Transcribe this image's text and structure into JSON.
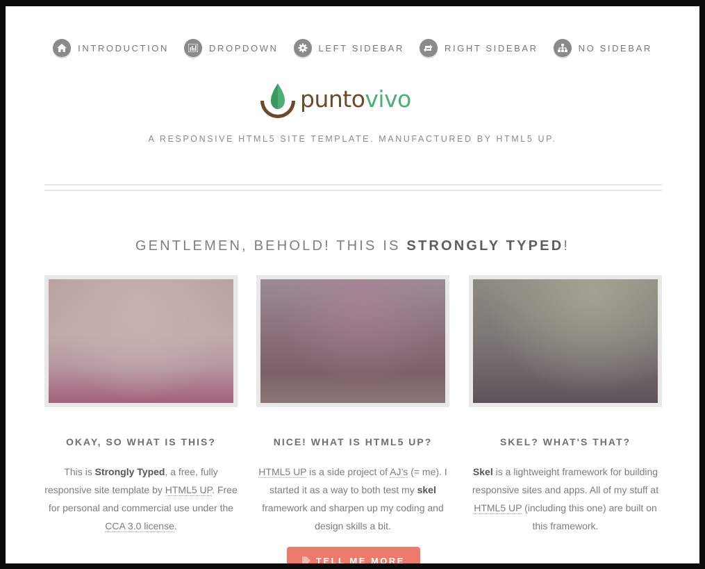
{
  "nav": {
    "items": [
      {
        "label": "INTRODUCTION",
        "icon": "home-icon"
      },
      {
        "label": "DROPDOWN",
        "icon": "bar-chart-icon"
      },
      {
        "label": "LEFT SIDEBAR",
        "icon": "gear-icon"
      },
      {
        "label": "RIGHT SIDEBAR",
        "icon": "retweet-icon"
      },
      {
        "label": "NO SIDEBAR",
        "icon": "sitemap-icon"
      }
    ]
  },
  "logo": {
    "part1": "punto",
    "part2": "vivo",
    "color1": "#6b4c2a",
    "color2": "#4caf74"
  },
  "tagline": "A RESPONSIVE HTML5 SITE TEMPLATE. MANUFACTURED BY HTML5 UP.",
  "heading": {
    "prefix": "GENTLEMEN, BEHOLD! THIS IS ",
    "strong": "STRONGLY TYPED",
    "suffix": "!"
  },
  "features": [
    {
      "title": "OKAY, SO WHAT IS THIS?",
      "t1": "This is ",
      "s1": "Strongly Typed",
      "t2": ", a free, fully responsive site template by ",
      "l1": "HTML5 UP",
      "t3": ". Free for personal and commercial use under the ",
      "l2": "CCA 3.0 license",
      "t4": "."
    },
    {
      "title": "NICE! WHAT IS HTML5 UP?",
      "l1": "HTML5 UP",
      "t1": " is a side project of ",
      "l2": "AJ’s",
      "t2": " (= me). I started it as a way to both test my ",
      "s1": "skel",
      "t3": " framework and sharpen up my coding and design skills a bit."
    },
    {
      "title": "SKEL? WHAT'S THAT?",
      "s1": "Skel",
      "t1": " is a lightweight framework for building responsive sites and apps. All of my stuff at ",
      "l1": "HTML5 UP",
      "t2": " (including this one) are built on this framework."
    }
  ],
  "cta": {
    "label": "TELL ME MORE"
  }
}
